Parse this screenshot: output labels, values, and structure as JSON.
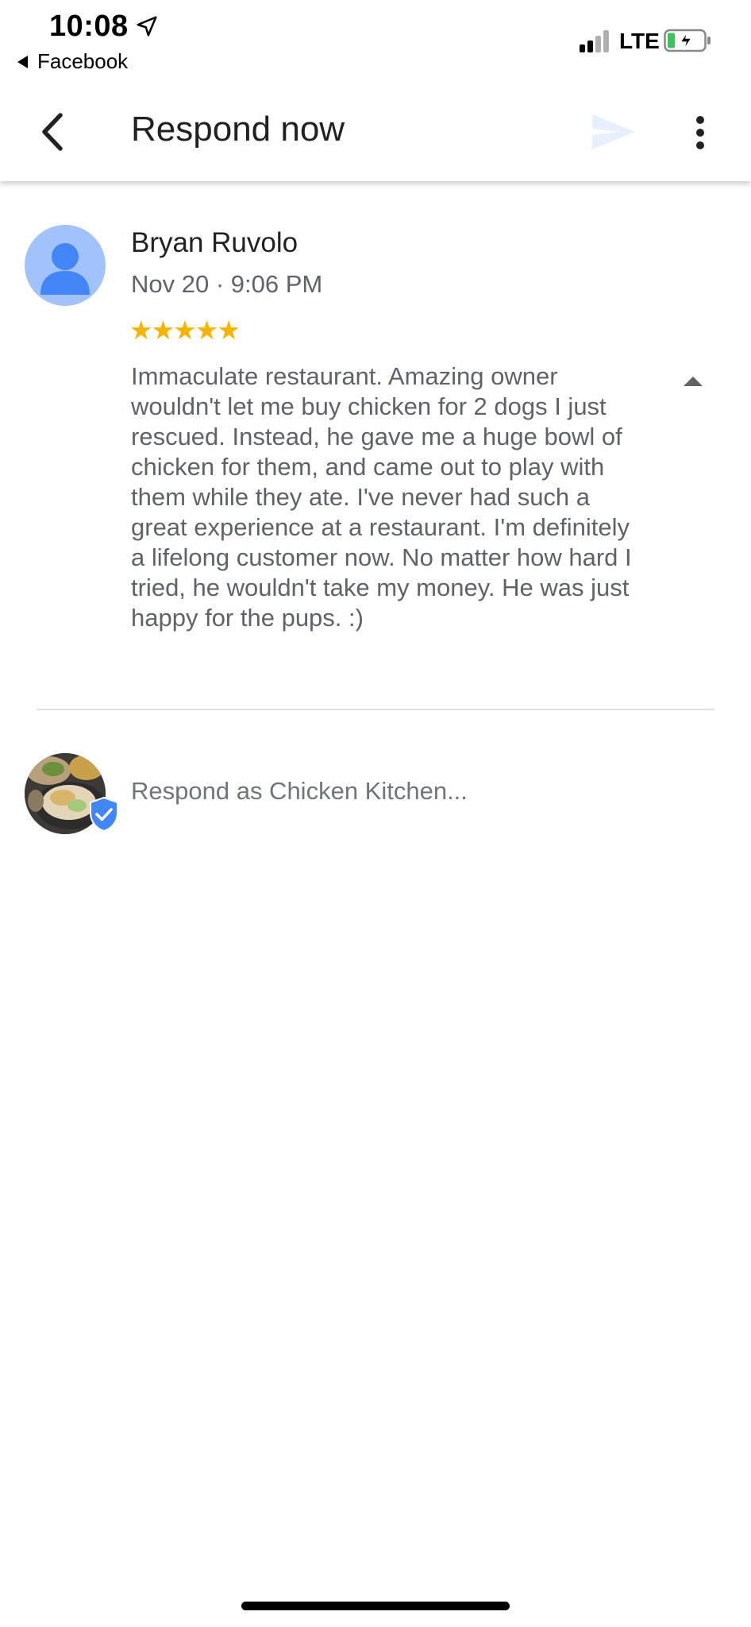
{
  "status_bar": {
    "time": "10:08",
    "back_app": "Facebook",
    "network": "LTE"
  },
  "app_bar": {
    "title": "Respond now",
    "back_icon": "chevron-left-icon",
    "send_icon": "send-icon",
    "more_icon": "more-vert-icon"
  },
  "review": {
    "reviewer_name": "Bryan Ruvolo",
    "date": "Nov 20 · 9:06 PM",
    "stars": "★★★★★",
    "rating": 5,
    "text": "Immaculate restaurant. Amazing owner wouldn't let me buy chicken for 2 dogs I just rescued. Instead, he gave me a huge bowl of chicken for them, and came out to play with them while they ate. I've never had such a great experience at a restaurant. I'm definitely a lifelong customer now. No matter how hard I tried, he wouldn't take my money. He was just happy for the pups. :)"
  },
  "respond": {
    "placeholder": "Respond as Chicken Kitchen..."
  },
  "colors": {
    "star": "#f4b400",
    "avatar_bg": "#a1c2fa",
    "avatar_fg": "#4285f4",
    "verified": "#4285f4",
    "send_disabled": "#e8f0fe"
  }
}
